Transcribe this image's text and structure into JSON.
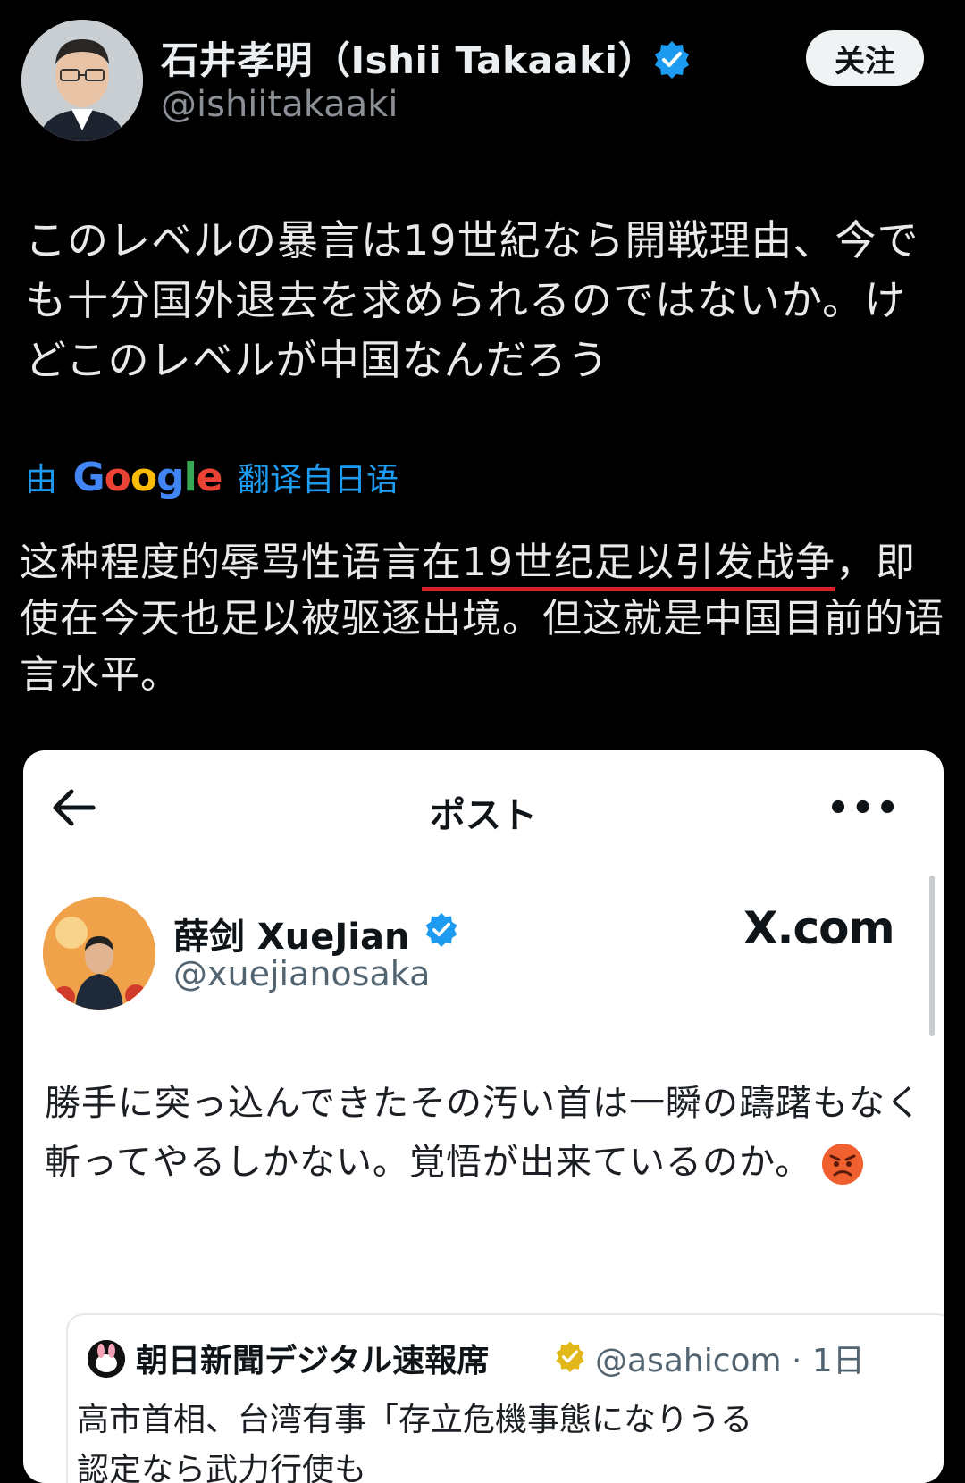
{
  "author": {
    "name": "石井孝明（Ishii Takaaki）",
    "handle": "@ishiitakaaki",
    "follow_label": "关注"
  },
  "tweet": {
    "original_jp": "このレベルの暴言は19世紀なら開戦理由、今でも十分国外退去を求められるのではないか。けどこのレベルが中国なんだろう",
    "translate_prefix": "由",
    "translate_suffix": "翻译自日语",
    "translated_before": "这种程度的辱骂性语言",
    "translated_underlined": "在19世纪足以引发战争",
    "translated_after": "，即使在今天也足以被驱逐出境。但这就是中国目前的语言水平。"
  },
  "embed": {
    "title": "ポスト",
    "name": "薛剑 XueJian",
    "handle": "@xuejianosaka",
    "site": "X.com",
    "text": "勝手に突っ込んできたその汚い首は一瞬の躊躇もなく斬ってやるしかない。覚悟が出来ているのか。",
    "quote": {
      "name": "朝日新聞デジタル速報席",
      "handle": "@asahicom · 1日",
      "line1": "高市首相、台湾有事「存立危機事態になりうる",
      "line2": "認定なら武力行使も"
    }
  },
  "colors": {
    "background": "#000000",
    "link_blue": "#1d9bf0",
    "underline_red": "#d6202b"
  },
  "icons": [
    "verified-badge-icon",
    "back-arrow-icon",
    "more-options-icon",
    "angry-face-emoji-icon",
    "gold-badge-icon"
  ]
}
